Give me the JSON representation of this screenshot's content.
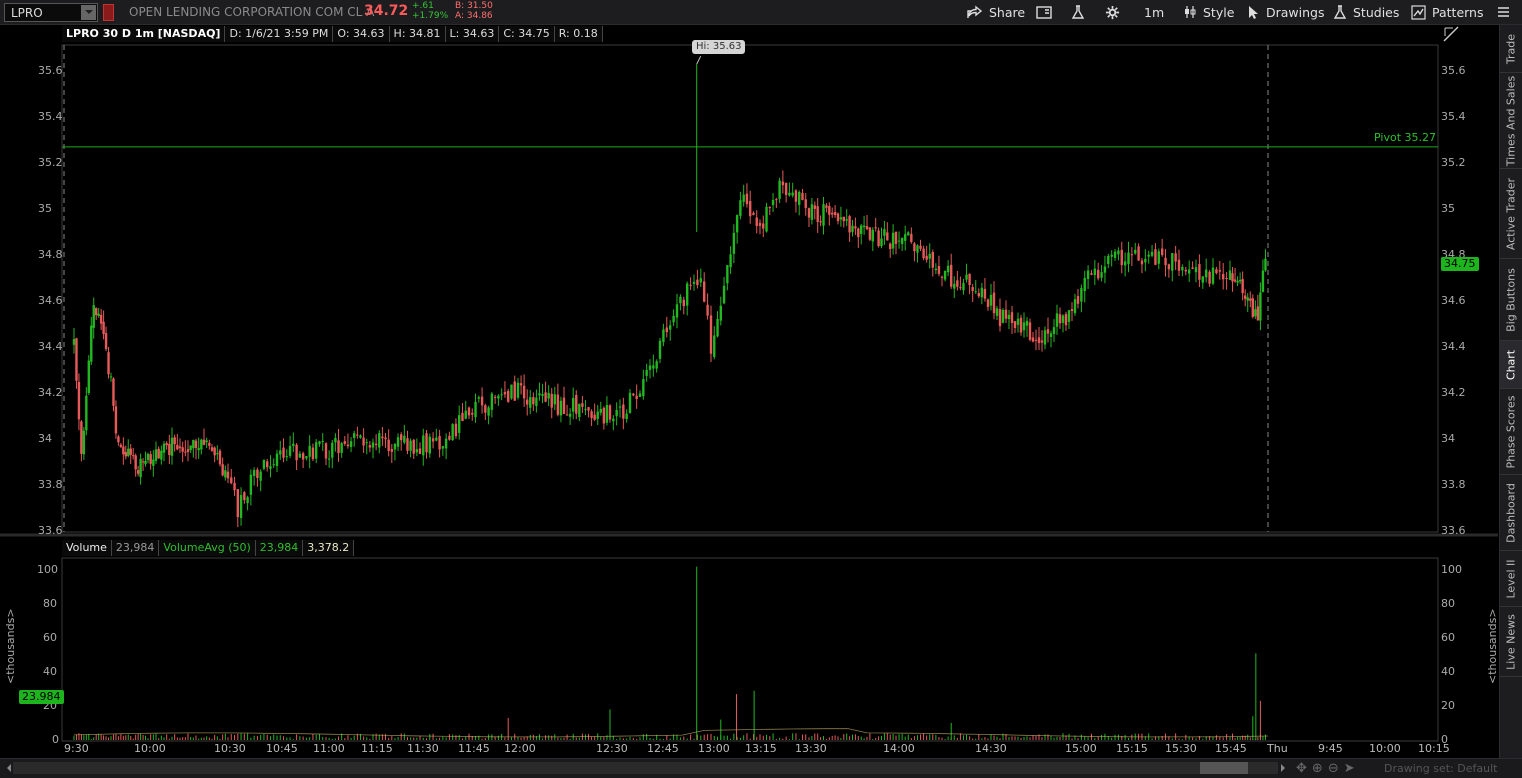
{
  "toolbar": {
    "symbol": "LPRO",
    "company": "OPEN LENDING CORPORATION COM CL A",
    "last": "34.72",
    "change": "+.61",
    "change_pct": "+1.79%",
    "bid": "B: 31.50",
    "ask": "A: 34.86",
    "share_label": "Share",
    "timeframe_label": "1m",
    "style_label": "Style",
    "drawings_label": "Drawings",
    "studies_label": "Studies",
    "patterns_label": "Patterns"
  },
  "info": {
    "symbol": "LPRO 30 D 1m [NASDAQ]",
    "date": "D: 1/6/21 3:59 PM",
    "open": "O: 34.63",
    "high": "H: 34.81",
    "low": "L: 34.63",
    "close": "C: 34.75",
    "range": "R: 0.18"
  },
  "volume_info": {
    "label": "Volume",
    "value": "23,984",
    "avg_label": "VolumeAvg (50)",
    "avg_value": "23,984",
    "avg2": "3,378.2"
  },
  "overlay": {
    "pivot_label": "Pivot 35.27",
    "hi_label": "Hi: 35.63",
    "price_tag": "34.75",
    "vol_tag": "23.984",
    "thousands_left": "<thousands>",
    "thousands_right": "<thousands>"
  },
  "colors": {
    "up": "#22b822",
    "down": "#e85a5a",
    "pivot": "#1fa81f",
    "background": "#000000"
  },
  "sidebar": {
    "tabs": [
      "Trade",
      "Times And Sales",
      "Active Trader",
      "Big Buttons",
      "Chart",
      "Phase Scores",
      "Dashboard",
      "Level II",
      "Live News"
    ]
  },
  "bottom": {
    "drawing_set": "Drawing set: Default"
  },
  "chart_data": {
    "type": "candlestick",
    "price_axis": {
      "ticks": [
        "35.6",
        "35.4",
        "35.2",
        "35",
        "34.8",
        "34.6",
        "34.4",
        "34.2",
        "34",
        "33.8",
        "33.6"
      ],
      "ylim": [
        33.6,
        35.7
      ]
    },
    "volume_axis": {
      "ticks": [
        "100",
        "80",
        "60",
        "40",
        "20",
        "0"
      ],
      "ylim": [
        0,
        100
      ],
      "unit": "thousands"
    },
    "x_ticks": [
      "9:30",
      "10:00",
      "10:30",
      "10:45",
      "11:00",
      "11:15",
      "11:30",
      "11:45",
      "12:00",
      "12:30",
      "12:45",
      "13:00",
      "13:15",
      "13:30",
      "14:00",
      "14:30",
      "15:00",
      "15:15",
      "15:30",
      "15:45",
      "Thu",
      "9:45",
      "10:00",
      "10:15"
    ],
    "pivot": 35.27,
    "high": 35.63,
    "waypoints": [
      [
        9.5,
        34.4
      ],
      [
        9.55,
        33.9
      ],
      [
        9.58,
        34.2
      ],
      [
        9.62,
        34.55
      ],
      [
        9.68,
        34.5
      ],
      [
        9.72,
        34.4
      ],
      [
        9.8,
        33.95
      ],
      [
        9.95,
        33.88
      ],
      [
        10.1,
        33.95
      ],
      [
        10.3,
        34.0
      ],
      [
        10.45,
        33.9
      ],
      [
        10.55,
        33.7
      ],
      [
        10.65,
        33.85
      ],
      [
        10.8,
        33.95
      ],
      [
        11.0,
        33.95
      ],
      [
        11.2,
        34.0
      ],
      [
        11.4,
        33.97
      ],
      [
        11.6,
        33.98
      ],
      [
        11.8,
        34.15
      ],
      [
        12.0,
        34.2
      ],
      [
        12.2,
        34.15
      ],
      [
        12.4,
        34.12
      ],
      [
        12.55,
        34.1
      ],
      [
        12.7,
        34.3
      ],
      [
        12.85,
        34.6
      ],
      [
        12.95,
        34.7
      ],
      [
        13.0,
        34.4
      ],
      [
        13.05,
        34.55
      ],
      [
        13.15,
        35.05
      ],
      [
        13.25,
        34.9
      ],
      [
        13.35,
        35.1
      ],
      [
        13.5,
        35.0
      ],
      [
        13.7,
        34.95
      ],
      [
        13.9,
        34.88
      ],
      [
        14.1,
        34.85
      ],
      [
        14.3,
        34.7
      ],
      [
        14.45,
        34.65
      ],
      [
        14.6,
        34.5
      ],
      [
        14.8,
        34.45
      ],
      [
        14.95,
        34.55
      ],
      [
        15.05,
        34.7
      ],
      [
        15.15,
        34.78
      ],
      [
        15.3,
        34.8
      ],
      [
        15.45,
        34.78
      ],
      [
        15.55,
        34.72
      ],
      [
        15.65,
        34.7
      ],
      [
        15.75,
        34.75
      ],
      [
        15.85,
        34.6
      ],
      [
        15.93,
        34.52
      ],
      [
        15.98,
        34.75
      ]
    ],
    "volume_spikes": [
      [
        12.93,
        102
      ],
      [
        13.05,
        12
      ],
      [
        13.13,
        27
      ],
      [
        13.22,
        29
      ],
      [
        15.92,
        51
      ],
      [
        15.95,
        23
      ],
      [
        15.9,
        14
      ],
      [
        12.5,
        18
      ],
      [
        11.95,
        13
      ],
      [
        14.3,
        10
      ]
    ]
  }
}
